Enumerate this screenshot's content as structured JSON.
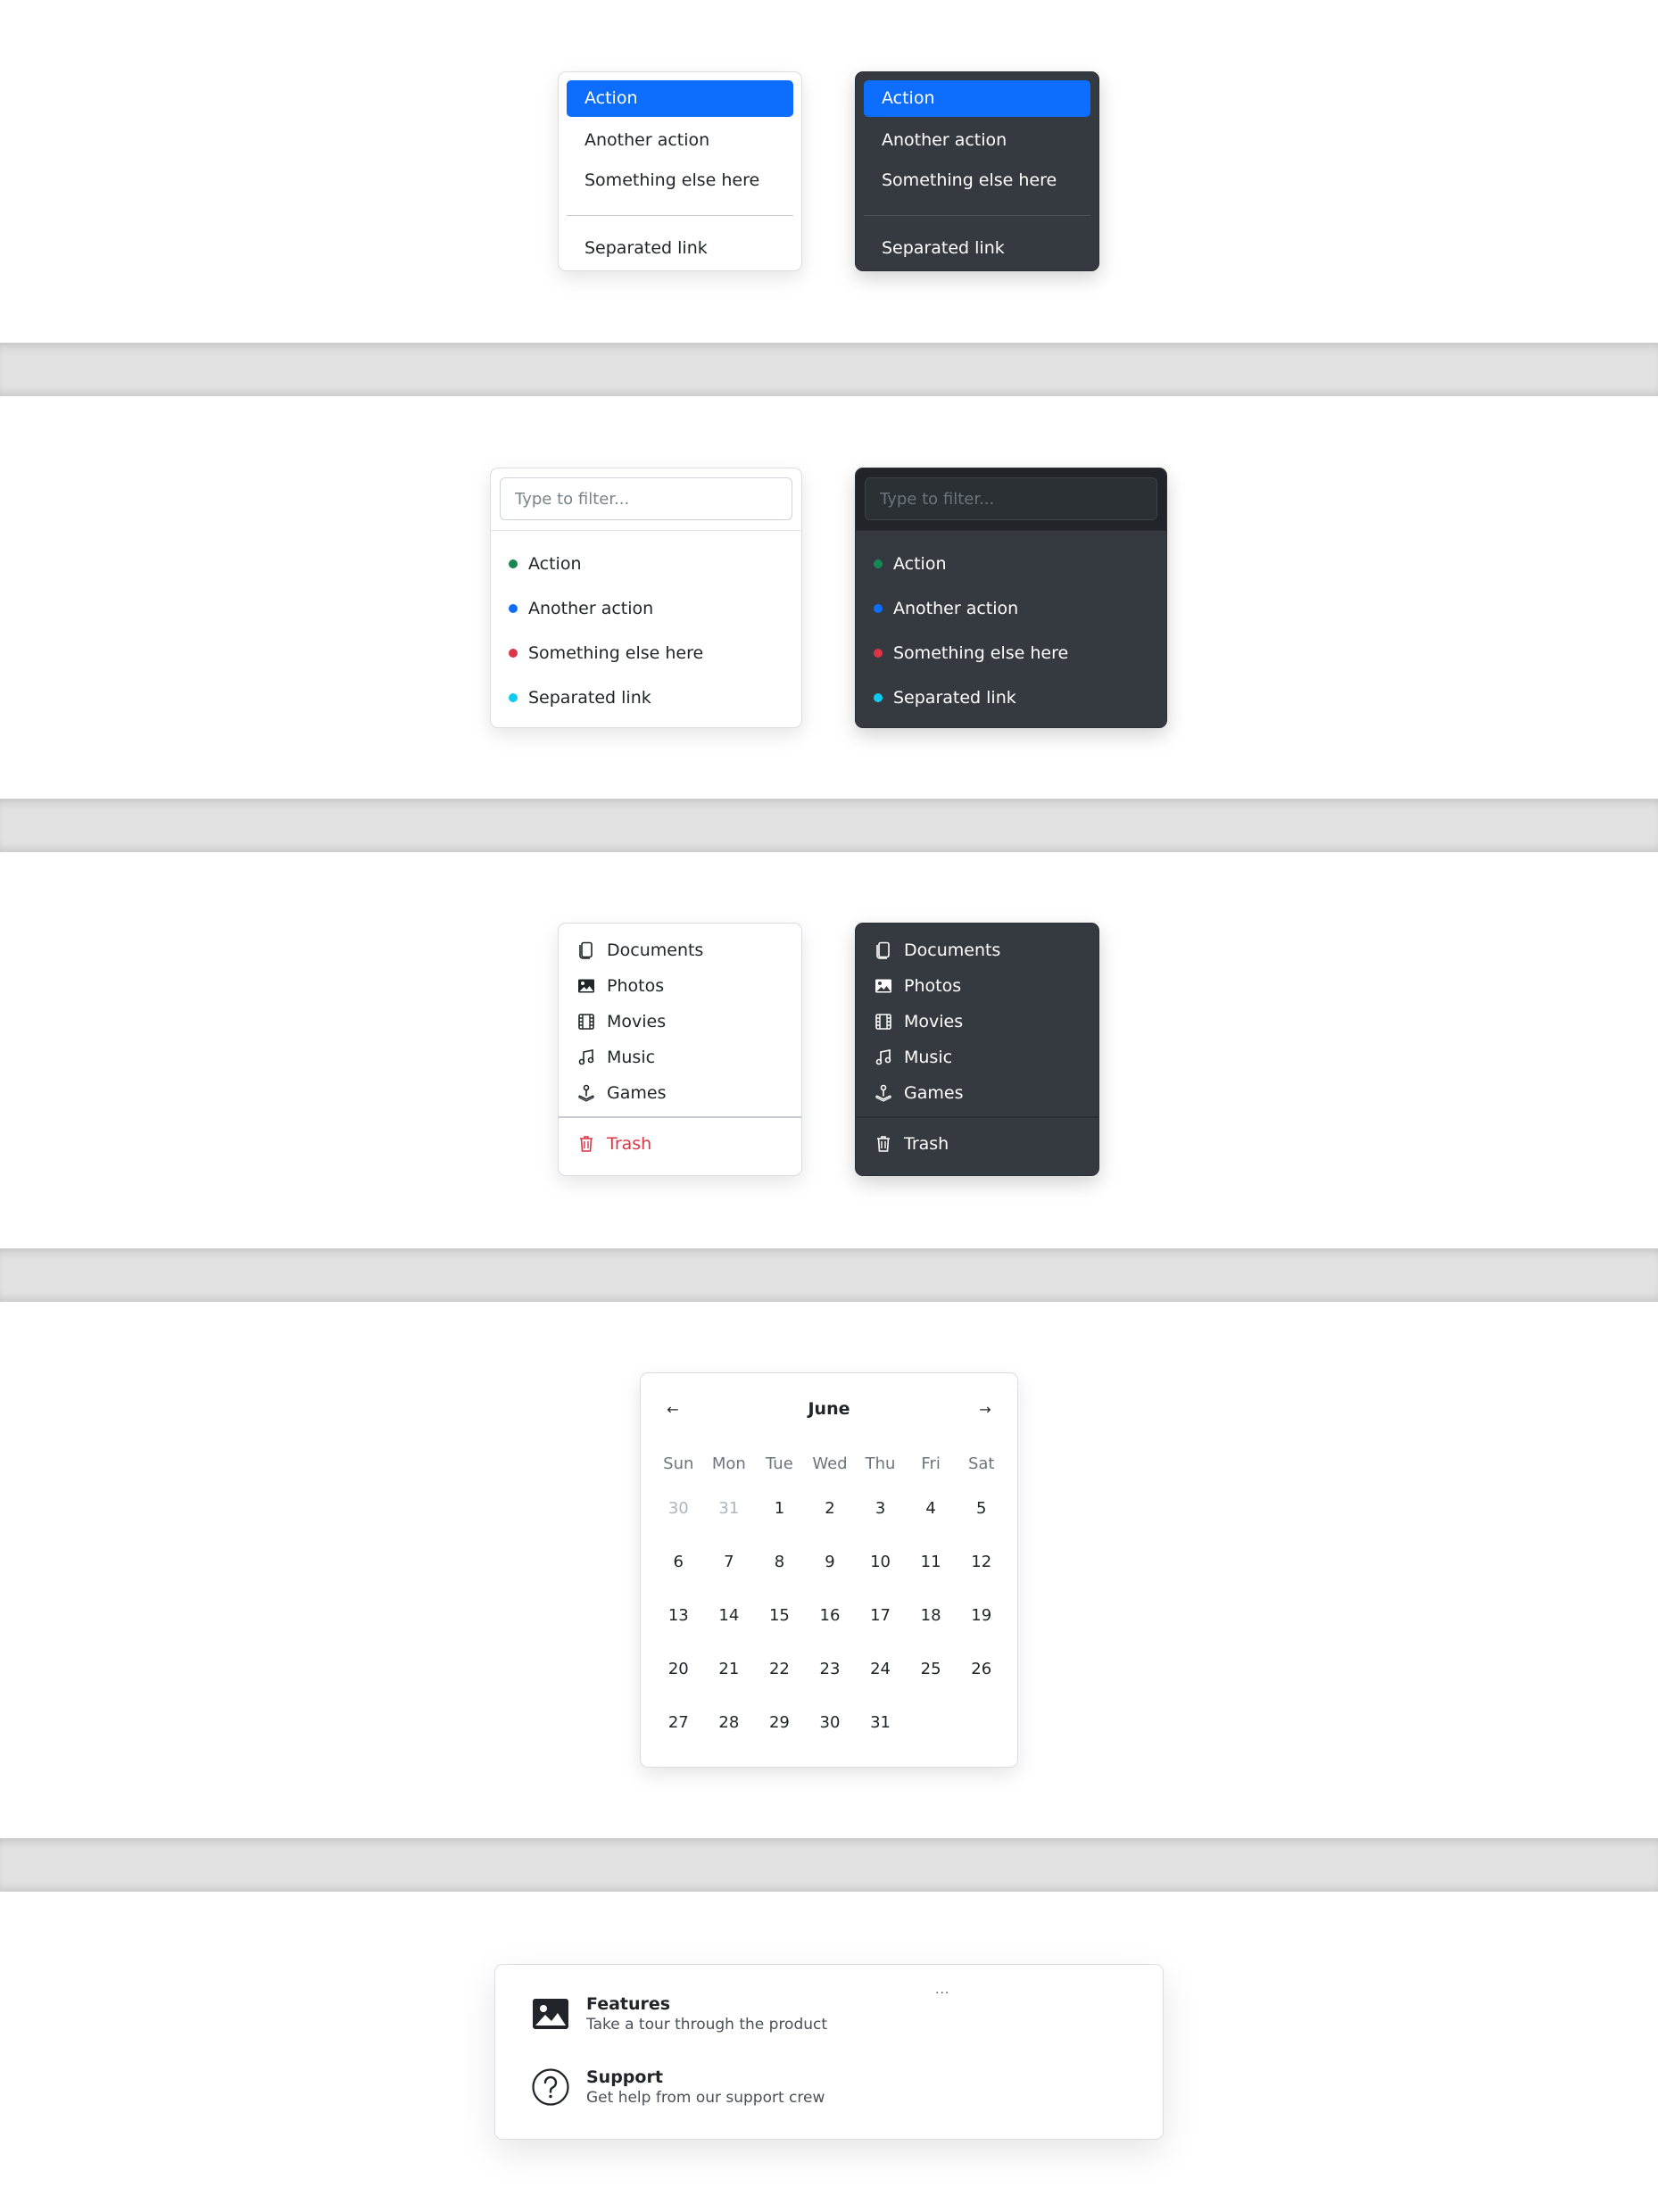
{
  "section1": {
    "items": [
      "Action",
      "Another action",
      "Something else here"
    ],
    "separated": "Separated link"
  },
  "section2": {
    "placeholder": "Type to filter...",
    "items": [
      {
        "label": "Action",
        "color": "#198754"
      },
      {
        "label": "Another action",
        "color": "#0d6efd"
      },
      {
        "label": "Something else here",
        "color": "#dc3545"
      },
      {
        "label": "Separated link",
        "color": "#0dcaf0"
      }
    ]
  },
  "section3": {
    "items": [
      {
        "label": "Documents",
        "icon": "files-icon"
      },
      {
        "label": "Photos",
        "icon": "image-icon"
      },
      {
        "label": "Movies",
        "icon": "film-icon"
      },
      {
        "label": "Music",
        "icon": "music-note-icon"
      },
      {
        "label": "Games",
        "icon": "joystick-icon"
      }
    ],
    "trash": "Trash"
  },
  "calendar": {
    "month": "June",
    "prev": "←",
    "next": "→",
    "weekdays": [
      "Sun",
      "Mon",
      "Tue",
      "Wed",
      "Thu",
      "Fri",
      "Sat"
    ],
    "weeks": [
      [
        "30",
        "31",
        "1",
        "2",
        "3",
        "4",
        "5"
      ],
      [
        "6",
        "7",
        "8",
        "9",
        "10",
        "11",
        "12"
      ],
      [
        "13",
        "14",
        "15",
        "16",
        "17",
        "18",
        "19"
      ],
      [
        "20",
        "21",
        "22",
        "23",
        "24",
        "25",
        "26"
      ],
      [
        "27",
        "28",
        "29",
        "30",
        "31"
      ]
    ],
    "muted_days": [
      "30",
      "31"
    ]
  },
  "features": {
    "ellipsis": "...",
    "items": [
      {
        "title": "Features",
        "subtitle": "Take a tour through the product",
        "icon": "image-icon"
      },
      {
        "title": "Support",
        "subtitle": "Get help from our support crew",
        "icon": "question-circle-icon"
      }
    ]
  },
  "colors": {
    "primary": "#0d6efd",
    "dark_menu": "#343a40",
    "danger": "#dc3545"
  }
}
